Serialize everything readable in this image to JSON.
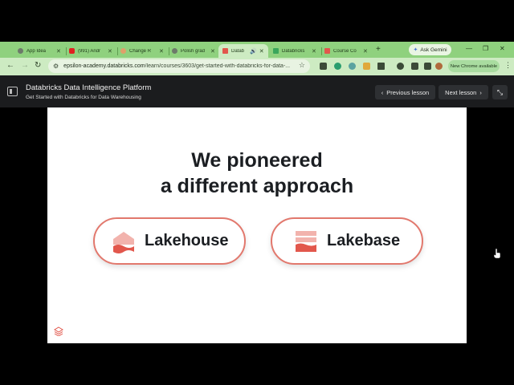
{
  "browser": {
    "tabs": [
      {
        "title": "App Idea"
      },
      {
        "title": "(991) Andr"
      },
      {
        "title": "Change R"
      },
      {
        "title": "Polish grad"
      },
      {
        "title": "Datab",
        "active": true
      },
      {
        "title": "Databricks"
      },
      {
        "title": "Course Co"
      }
    ],
    "new_tab": "+",
    "gemini_label": "Ask Gemini",
    "url_host": "epsilon-academy.databricks.com",
    "url_path": "/learn/courses/3603/get-started-with-databricks-for-data-...",
    "new_chrome_label": "New Chrome available",
    "colors": {
      "frame": "#8fd17e",
      "toolbar": "#cdebc2"
    }
  },
  "course": {
    "title": "Databricks Data Intelligence Platform",
    "subtitle": "Get Started with Databricks for Data Warehousing",
    "previous_label": "Previous lesson",
    "next_label": "Next lesson"
  },
  "slide": {
    "headline_line1": "We pioneered",
    "headline_line2": "a different approach",
    "pills": [
      {
        "label": "Lakehouse",
        "icon": "lakehouse-icon"
      },
      {
        "label": "Lakebase",
        "icon": "lakebase-icon"
      }
    ],
    "accent_color": "#e2786d"
  }
}
